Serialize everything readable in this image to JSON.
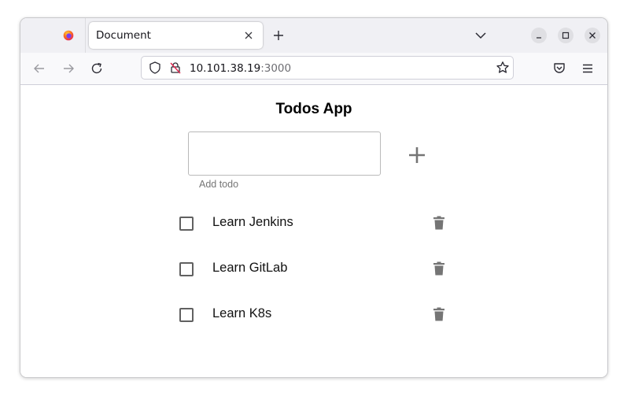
{
  "browser": {
    "tab": {
      "title": "Document"
    },
    "url": {
      "host": "10.101.38.19",
      "port": ":3000"
    },
    "icons": {
      "browser_logo": "firefox-icon",
      "tab_close": "close-icon",
      "new_tab": "plus-icon",
      "list_tabs": "chevron-down-icon",
      "minimize": "minimize-icon",
      "maximize": "maximize-icon",
      "close_window": "close-icon",
      "back": "arrow-left-icon",
      "forward": "arrow-right-icon",
      "reload": "reload-icon",
      "tracking_protection": "shield-icon",
      "site_security": "lock-icon",
      "bookmark": "star-icon",
      "pocket": "pocket-icon",
      "app_menu": "hamburger-menu-icon"
    }
  },
  "app": {
    "title": "Todos App",
    "input": {
      "value": "",
      "helper": "Add todo"
    },
    "todos": [
      {
        "text": "Learn Jenkins",
        "done": false
      },
      {
        "text": "Learn GitLab",
        "done": false
      },
      {
        "text": "Learn K8s",
        "done": false
      }
    ],
    "colors": {
      "icon_gray": "#757575",
      "text": "#111111"
    }
  }
}
